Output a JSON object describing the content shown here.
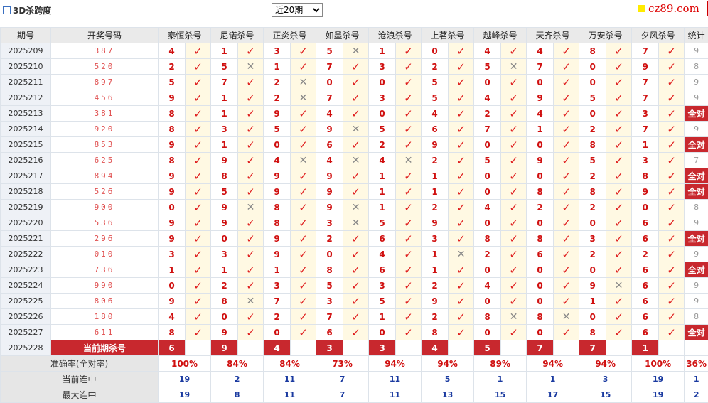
{
  "header": {
    "title": "3D杀跨度",
    "select_value": "近20期",
    "logo_text": "cz89.com"
  },
  "columns": {
    "period": "期号",
    "draw": "开奖号码",
    "stat": "统计",
    "experts": [
      "泰恒杀号",
      "尼诺杀号",
      "正炎杀号",
      "如墨杀号",
      "沧浪杀号",
      "上茗杀号",
      "越峰杀号",
      "天齐杀号",
      "万安杀号",
      "夕风杀号"
    ]
  },
  "rows": [
    {
      "period": "2025209",
      "draw": "387",
      "nums": [
        4,
        1,
        3,
        5,
        1,
        0,
        4,
        4,
        8,
        7
      ],
      "marks": "YYYNYYYYYY",
      "stat": "9"
    },
    {
      "period": "2025210",
      "draw": "520",
      "nums": [
        2,
        5,
        1,
        7,
        3,
        2,
        5,
        7,
        0,
        9
      ],
      "marks": "YNYYYYNYYY",
      "stat": "8"
    },
    {
      "period": "2025211",
      "draw": "897",
      "nums": [
        5,
        7,
        2,
        0,
        0,
        5,
        0,
        0,
        0,
        7
      ],
      "marks": "YYNYYYYYYY",
      "stat": "9"
    },
    {
      "period": "2025212",
      "draw": "456",
      "nums": [
        9,
        1,
        2,
        7,
        3,
        5,
        4,
        9,
        5,
        7
      ],
      "marks": "YYNYYYYYYY",
      "stat": "9"
    },
    {
      "period": "2025213",
      "draw": "381",
      "nums": [
        8,
        1,
        9,
        4,
        0,
        4,
        2,
        4,
        0,
        3
      ],
      "marks": "YYYYYYYYYY",
      "stat": "全对"
    },
    {
      "period": "2025214",
      "draw": "920",
      "nums": [
        8,
        3,
        5,
        9,
        5,
        6,
        7,
        1,
        2,
        7
      ],
      "marks": "YYYNYYYYYY",
      "stat": "9"
    },
    {
      "period": "2025215",
      "draw": "853",
      "nums": [
        9,
        1,
        0,
        6,
        2,
        9,
        0,
        0,
        8,
        1
      ],
      "marks": "YYYYYYYYYY",
      "stat": "全对"
    },
    {
      "period": "2025216",
      "draw": "625",
      "nums": [
        8,
        9,
        4,
        4,
        4,
        2,
        5,
        9,
        5,
        3
      ],
      "marks": "YYNNNYYYYY",
      "stat": "7"
    },
    {
      "period": "2025217",
      "draw": "894",
      "nums": [
        9,
        8,
        9,
        9,
        1,
        1,
        0,
        0,
        2,
        8
      ],
      "marks": "YYYYYYYYYY",
      "stat": "全对"
    },
    {
      "period": "2025218",
      "draw": "526",
      "nums": [
        9,
        5,
        9,
        9,
        1,
        1,
        0,
        8,
        8,
        9
      ],
      "marks": "YYYYYYYYYY",
      "stat": "全对"
    },
    {
      "period": "2025219",
      "draw": "900",
      "nums": [
        0,
        9,
        8,
        9,
        1,
        2,
        4,
        2,
        2,
        0
      ],
      "marks": "YNYNYYYYYY",
      "stat": "8"
    },
    {
      "period": "2025220",
      "draw": "536",
      "nums": [
        9,
        9,
        8,
        3,
        5,
        9,
        0,
        0,
        0,
        6
      ],
      "marks": "YYYNYYYYYY",
      "stat": "9"
    },
    {
      "period": "2025221",
      "draw": "296",
      "nums": [
        9,
        0,
        9,
        2,
        6,
        3,
        8,
        8,
        3,
        6
      ],
      "marks": "YYYYYYYYYY",
      "stat": "全对"
    },
    {
      "period": "2025222",
      "draw": "010",
      "nums": [
        3,
        3,
        9,
        0,
        4,
        1,
        2,
        6,
        2,
        2
      ],
      "marks": "YYYYYNYYYY",
      "stat": "9"
    },
    {
      "period": "2025223",
      "draw": "736",
      "nums": [
        1,
        1,
        1,
        8,
        6,
        1,
        0,
        0,
        0,
        6
      ],
      "marks": "YYYYYYYYYY",
      "stat": "全对"
    },
    {
      "period": "2025224",
      "draw": "990",
      "nums": [
        0,
        2,
        3,
        5,
        3,
        2,
        4,
        0,
        9,
        6
      ],
      "marks": "YYYYYYYYNY",
      "stat": "9"
    },
    {
      "period": "2025225",
      "draw": "806",
      "nums": [
        9,
        8,
        7,
        3,
        5,
        9,
        0,
        0,
        1,
        6
      ],
      "marks": "YNYYYYYYYY",
      "stat": "9"
    },
    {
      "period": "2025226",
      "draw": "180",
      "nums": [
        4,
        0,
        2,
        7,
        1,
        2,
        8,
        8,
        0,
        6
      ],
      "marks": "YYYYYYNNYY",
      "stat": "8"
    },
    {
      "period": "2025227",
      "draw": "611",
      "nums": [
        8,
        9,
        0,
        6,
        0,
        8,
        0,
        0,
        8,
        6
      ],
      "marks": "YYYYYYYYYY",
      "stat": "全对"
    }
  ],
  "current": {
    "period": "2025228",
    "label": "当前期杀号",
    "nums": [
      "6",
      "9",
      "4",
      "3",
      "3",
      "4",
      "5",
      "7",
      "7",
      "1"
    ]
  },
  "summary": [
    {
      "label": "准确率(全对率)",
      "type": "pct",
      "values": [
        "100%",
        "84%",
        "84%",
        "73%",
        "94%",
        "94%",
        "89%",
        "94%",
        "94%",
        "100%"
      ],
      "stat": "36%"
    },
    {
      "label": "当前连中",
      "type": "streak",
      "values": [
        "19",
        "2",
        "11",
        "7",
        "11",
        "5",
        "1",
        "1",
        "3",
        "19"
      ],
      "stat": "1"
    },
    {
      "label": "最大连中",
      "type": "streak",
      "values": [
        "19",
        "8",
        "11",
        "7",
        "11",
        "13",
        "15",
        "17",
        "15",
        "19"
      ],
      "stat": "2"
    }
  ],
  "icons": {
    "correct": "check-icon",
    "wrong": "cross-icon"
  },
  "colors": {
    "accent": "#c8282e",
    "number": "#d01010",
    "streak": "#1a3aa0",
    "mark_bg": "#fff9e3"
  }
}
